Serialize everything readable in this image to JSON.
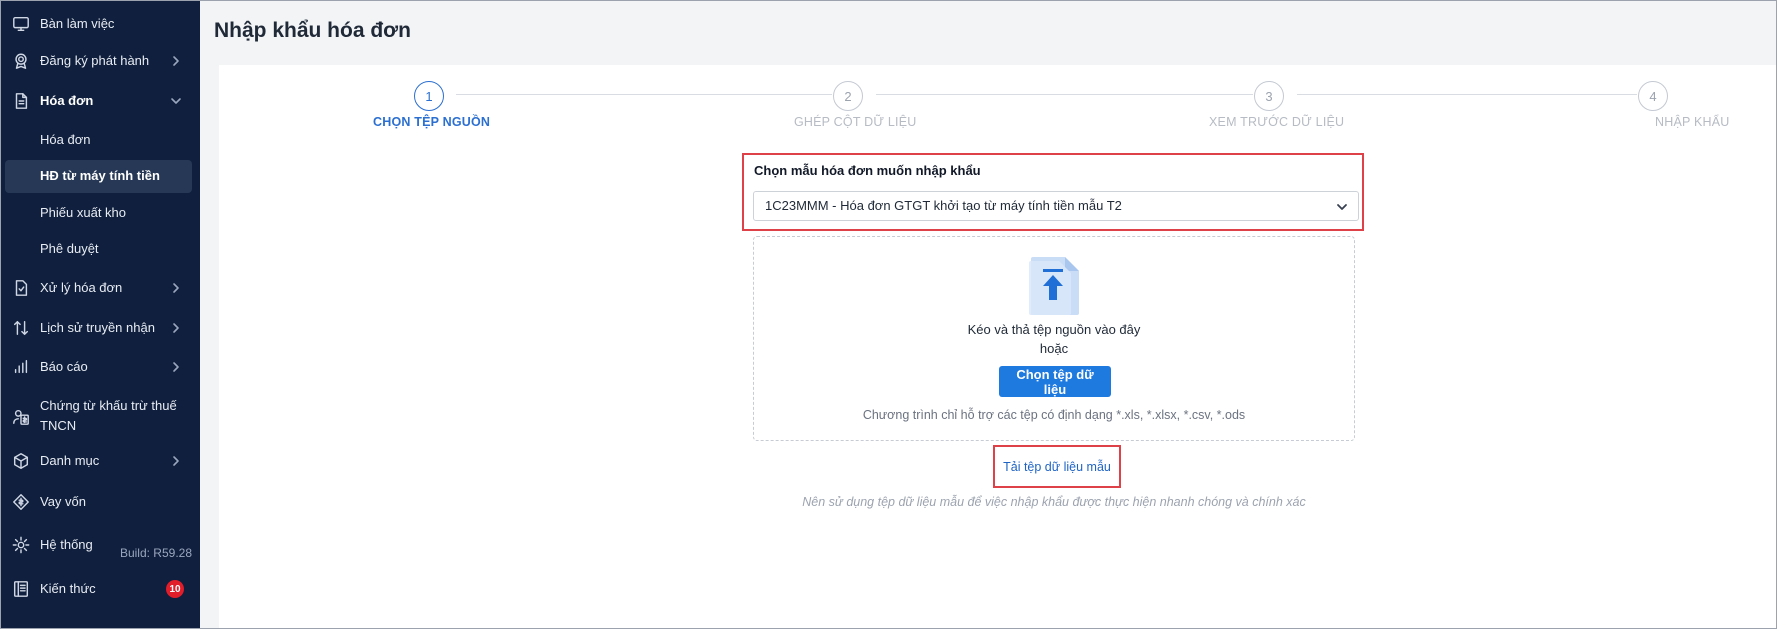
{
  "sidebar": {
    "items": [
      {
        "label": "Bàn làm việc",
        "icon": "monitor-icon"
      },
      {
        "label": "Đăng ký phát hành",
        "icon": "badge-icon"
      },
      {
        "label": "Hóa đơn",
        "icon": "document-icon"
      },
      {
        "label": "Xử lý hóa đơn",
        "icon": "document-check-icon"
      },
      {
        "label": "Lịch sử truyền nhận",
        "icon": "transfer-arrows-icon"
      },
      {
        "label": "Báo cáo",
        "icon": "bar-chart-icon"
      },
      {
        "label": "Chứng từ khấu trừ thuế TNCN",
        "line1": "Chứng từ khấu trừ thuế",
        "line2": "TNCN",
        "icon": "tax-receipt-icon"
      },
      {
        "label": "Danh mục",
        "icon": "box-icon"
      },
      {
        "label": "Vay vốn",
        "icon": "loan-icon"
      },
      {
        "label": "Hệ thống",
        "icon": "gear-icon"
      },
      {
        "label": "Kiến thức",
        "icon": "book-icon"
      }
    ],
    "sub_items": [
      "Hóa đơn",
      "HĐ từ máy tính tiền",
      "Phiếu xuất kho",
      "Phê duyệt"
    ],
    "active_sub_item": "HĐ từ máy tính tiền",
    "build": "Build: R59.28",
    "knowledge_badge": "10"
  },
  "page": {
    "title": "Nhập khẩu hóa đơn"
  },
  "steps": [
    {
      "number": "1",
      "label": "CHỌN TỆP NGUỒN",
      "active": true
    },
    {
      "number": "2",
      "label": "GHÉP CỘT DỮ LIỆU",
      "active": false
    },
    {
      "number": "3",
      "label": "XEM TRƯỚC DỮ LIỆU",
      "active": false
    },
    {
      "number": "4",
      "label": "NHẬP KHẨU",
      "active": false
    }
  ],
  "template": {
    "label": "Chọn mẫu hóa đơn muốn nhập khẩu",
    "selected": "1C23MMM - Hóa đơn GTGT khởi tạo từ máy tính tiền mẫu T2"
  },
  "dropzone": {
    "line1": "Kéo và thả tệp nguồn vào đây",
    "line2": "hoặc",
    "button": "Chọn tệp dữ liệu",
    "support": "Chương trình chỉ hỗ trợ các tệp có định dạng *.xls, *.xlsx, *.csv, *.ods"
  },
  "download_link": "Tải tệp dữ liệu mẫu",
  "hint": "Nên sử dụng tệp dữ liệu mẫu để việc nhập khẩu được thực hiện nhanh chóng và chính xác",
  "colors": {
    "sidebar_bg": "#0f1f3d",
    "accent": "#2b6fd1",
    "button": "#1f7ae0",
    "highlight": "#df4148",
    "badge": "#e11d2a"
  }
}
